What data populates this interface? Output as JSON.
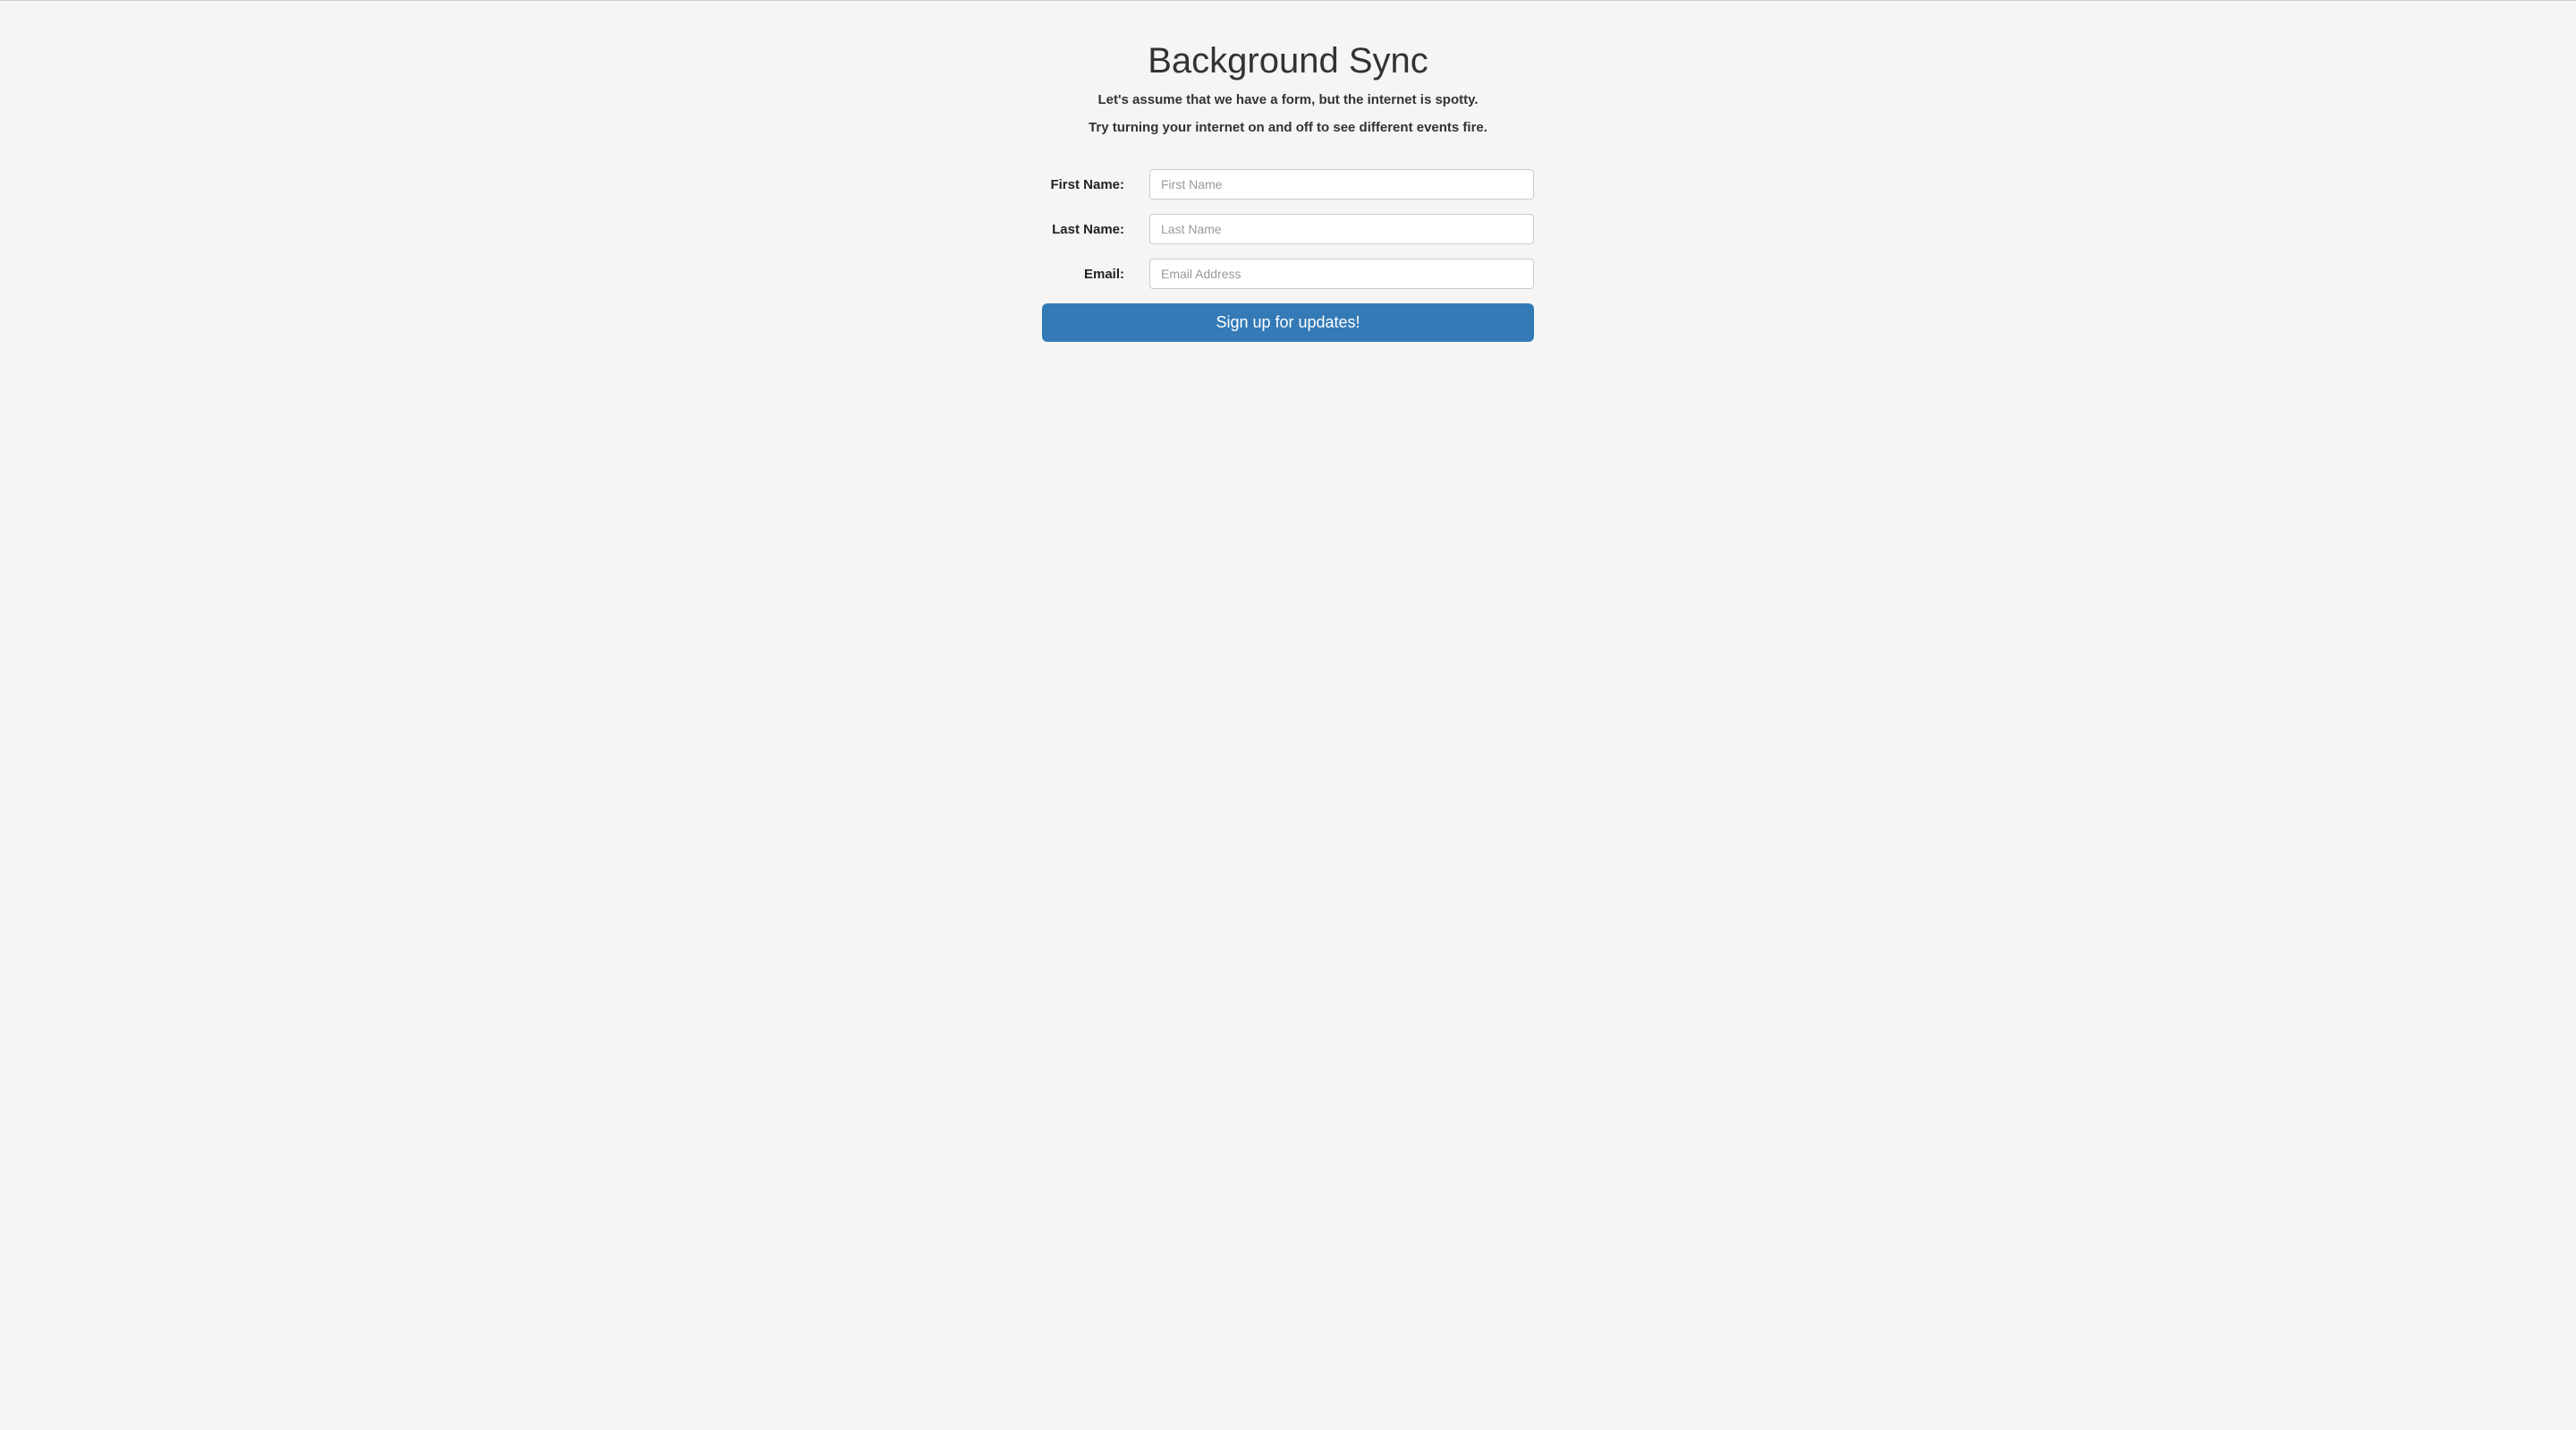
{
  "header": {
    "title": "Background Sync",
    "subtitle1": "Let's assume that we have a form, but the internet is spotty.",
    "subtitle2": "Try turning your internet on and off to see different events fire."
  },
  "form": {
    "fields": [
      {
        "label": "First Name:",
        "placeholder": "First Name",
        "value": ""
      },
      {
        "label": "Last Name:",
        "placeholder": "Last Name",
        "value": ""
      },
      {
        "label": "Email:",
        "placeholder": "Email Address",
        "value": ""
      }
    ],
    "submit_label": "Sign up for updates!"
  }
}
